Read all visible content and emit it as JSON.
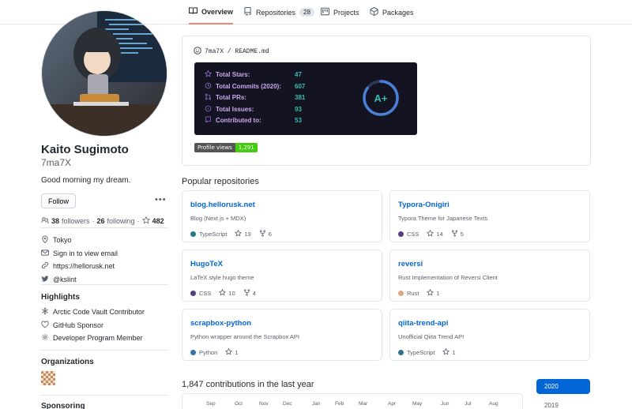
{
  "nav": {
    "tabs": [
      {
        "label": "Overview",
        "icon": "book-icon",
        "active": true
      },
      {
        "label": "Repositories",
        "icon": "repo-icon",
        "count": "28"
      },
      {
        "label": "Projects",
        "icon": "project-icon"
      },
      {
        "label": "Packages",
        "icon": "package-icon"
      }
    ]
  },
  "profile": {
    "name": "Kaito Sugimoto",
    "login": "7ma7X",
    "bio": "Good morning my dream.",
    "follow_label": "Follow",
    "more_label": "•••",
    "followers_count": "38",
    "followers_label": "followers",
    "following_count": "26",
    "following_label": "following",
    "stars_count": "482",
    "location": "Tokyo",
    "email": "Sign in to view email",
    "website": "https://hellorusk.net",
    "twitter": "@kslint"
  },
  "highlights": {
    "title": "Highlights",
    "items": [
      "Arctic Code Vault Contributor",
      "GitHub Sponsor",
      "Developer Program Member"
    ]
  },
  "organizations": {
    "title": "Organizations"
  },
  "sponsoring": {
    "title": "Sponsoring"
  },
  "readme": {
    "path": "7ma7X / README.md",
    "stats": [
      {
        "label": "Total Stars:",
        "value": "47",
        "icon": "star-icon"
      },
      {
        "label": "Total Commits (2020):",
        "value": "607",
        "icon": "history-icon"
      },
      {
        "label": "Total PRs:",
        "value": "381",
        "icon": "pull-request-icon"
      },
      {
        "label": "Total Issues:",
        "value": "93",
        "icon": "issue-icon"
      },
      {
        "label": "Contributed to:",
        "value": "53",
        "icon": "repo-icon"
      }
    ],
    "grade": "A+",
    "grade_fraction": 0.85,
    "views_label": "Profile views",
    "views_value": "1,291",
    "colors": {
      "card_bg": "#141321",
      "label": "#c8a8f0",
      "value": "#38bdae"
    }
  },
  "popular": {
    "title": "Popular repositories",
    "repos": [
      {
        "name": "blog.hellorusk.net",
        "desc": "Blog (Next.js + MDX)",
        "lang": "TypeScript",
        "color": "#2b7489",
        "stars": "19",
        "forks": "6"
      },
      {
        "name": "Typora-Onigiri",
        "desc": "Typora Theme for Japanese Texts",
        "lang": "CSS",
        "color": "#563d7c",
        "stars": "14",
        "forks": "5"
      },
      {
        "name": "HugoTeX",
        "desc": "LaTeX style hugo theme",
        "lang": "CSS",
        "color": "#563d7c",
        "stars": "10",
        "forks": "4"
      },
      {
        "name": "reversi",
        "desc": "Rust Implementation of Reversi Client",
        "lang": "Rust",
        "color": "#dea584",
        "stars": "1",
        "forks": ""
      },
      {
        "name": "scrapbox-python",
        "desc": "Python wrapper around the Scrapbox API",
        "lang": "Python",
        "color": "#3572A5",
        "stars": "1",
        "forks": ""
      },
      {
        "name": "qiita-trend-api",
        "desc": "Unofficial Qiita Trend API",
        "lang": "TypeScript",
        "color": "#2b7489",
        "stars": "1",
        "forks": ""
      }
    ]
  },
  "contributions": {
    "title": "1,847 contributions in the last year",
    "months": [
      "Sep",
      "Oct",
      "Nov",
      "Dec",
      "Jan",
      "Feb",
      "Mar",
      "Apr",
      "May",
      "Jun",
      "Jul",
      "Aug"
    ],
    "years": [
      "2020",
      "2019"
    ]
  }
}
